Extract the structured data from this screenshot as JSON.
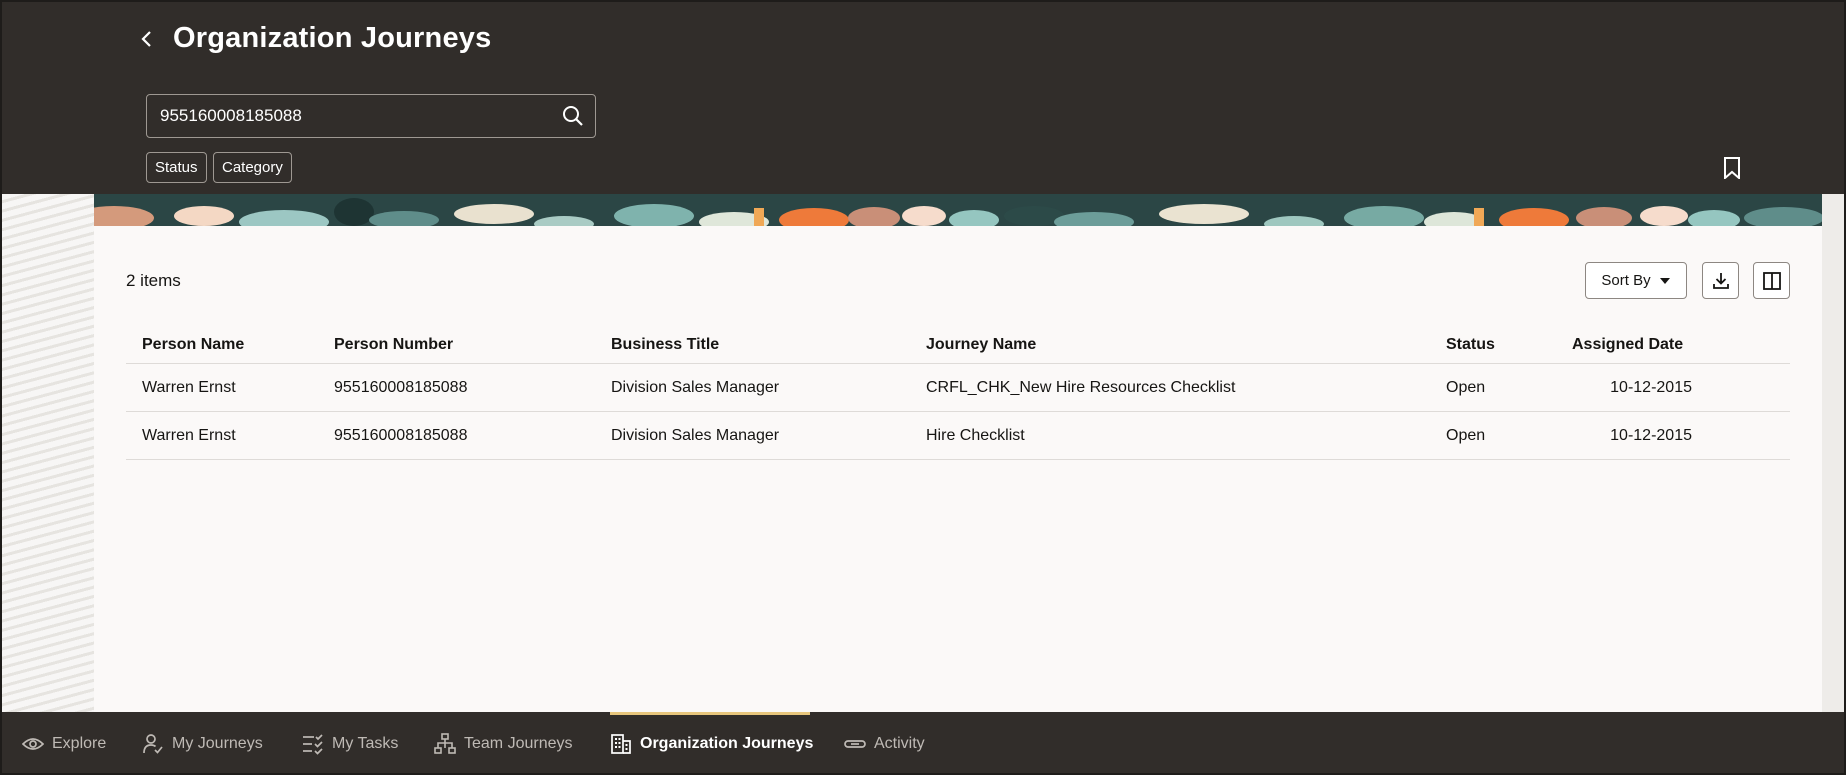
{
  "header": {
    "title": "Organization Journeys",
    "search_value": "955160008185088",
    "filters": [
      "Status",
      "Category"
    ]
  },
  "content": {
    "items_count": "2 items",
    "sort_label": "Sort By",
    "columns": [
      "Person Name",
      "Person Number",
      "Business Title",
      "Journey Name",
      "Status",
      "Assigned Date"
    ],
    "rows": [
      [
        "Warren Ernst",
        "955160008185088",
        "Division Sales Manager",
        "CRFL_CHK_New Hire Resources Checklist",
        "Open",
        "10-12-2015"
      ],
      [
        "Warren Ernst",
        "955160008185088",
        "Division Sales Manager",
        "Hire Checklist",
        "Open",
        "10-12-2015"
      ]
    ]
  },
  "nav": {
    "items": [
      {
        "label": "Explore",
        "icon": "eye-icon"
      },
      {
        "label": "My Journeys",
        "icon": "person-check-icon"
      },
      {
        "label": "My Tasks",
        "icon": "checklist-icon"
      },
      {
        "label": "Team Journeys",
        "icon": "org-chart-icon"
      },
      {
        "label": "Organization Journeys",
        "icon": "building-icon"
      },
      {
        "label": "Activity",
        "icon": "link-icon"
      }
    ],
    "active_index": 4
  },
  "colors": {
    "header_bg": "#312d2a",
    "content_bg": "#fbf9f8",
    "active_accent": "#e8c67d"
  }
}
